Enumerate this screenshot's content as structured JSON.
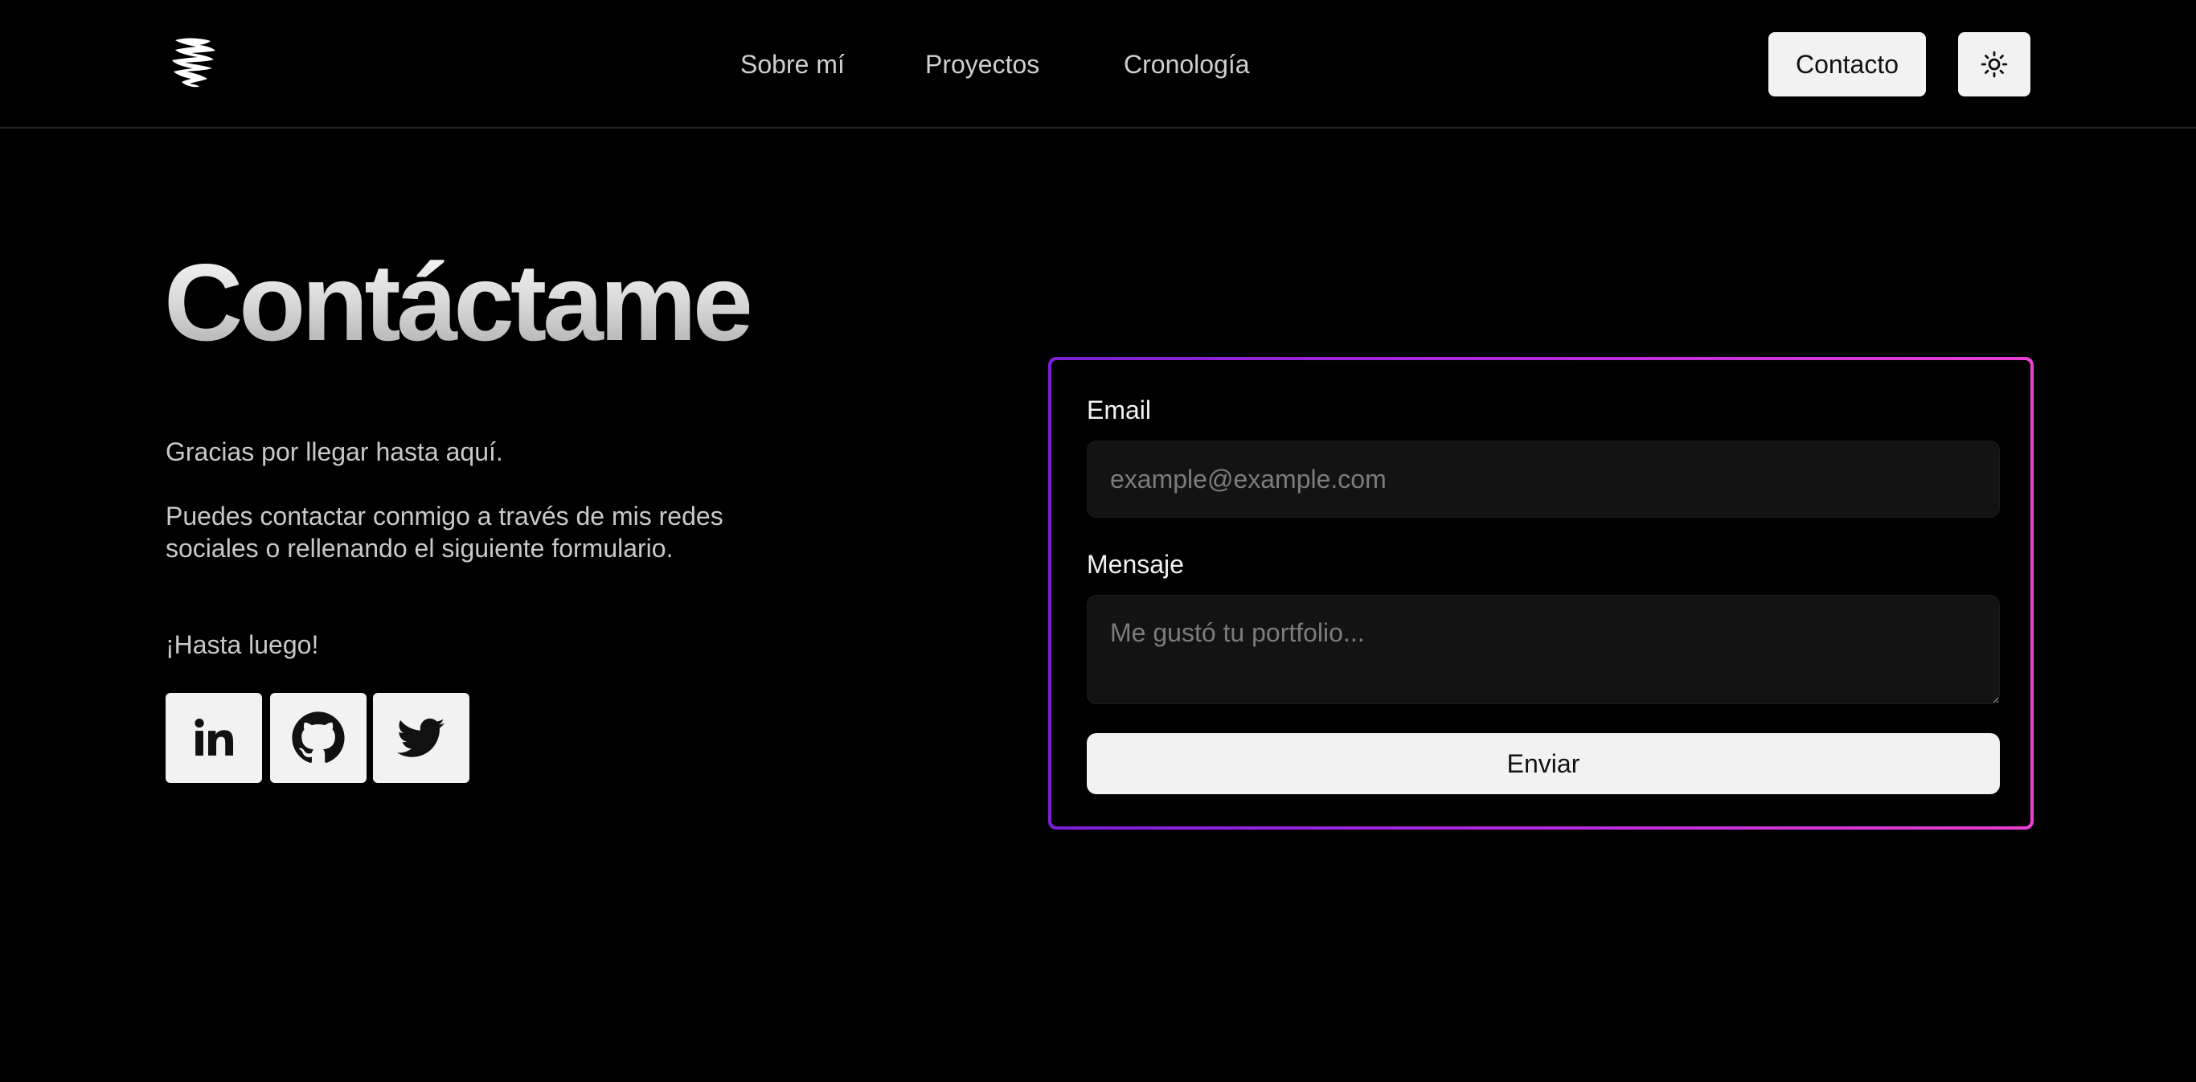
{
  "header": {
    "logo_icon": "abstract-white-brush-logo",
    "nav": [
      {
        "label": "Sobre mí"
      },
      {
        "label": "Proyectos"
      },
      {
        "label": "Cronología"
      }
    ],
    "contact_label": "Contacto",
    "theme_toggle_icon": "sun-icon"
  },
  "main": {
    "title": "Contáctame",
    "paragraphs": [
      "Gracias por llegar hasta aquí.",
      "Puedes contactar conmigo a través de mis redes sociales o rellenando el siguiente formulario.",
      "¡Hasta luego!"
    ],
    "socials": [
      {
        "icon": "linkedin-icon"
      },
      {
        "icon": "github-icon"
      },
      {
        "icon": "twitter-icon"
      }
    ]
  },
  "form": {
    "email_label": "Email",
    "email_value": "",
    "email_placeholder": "example@example.com",
    "message_label": "Mensaje",
    "message_value": "",
    "message_placeholder": "Me gustó tu portfolio...",
    "submit_label": "Enviar",
    "border_gradient": [
      "#7a1fd6",
      "#ea3fd1"
    ]
  },
  "colors": {
    "background": "#000000",
    "button_bg": "#f2f2f2",
    "input_bg": "#131313"
  }
}
